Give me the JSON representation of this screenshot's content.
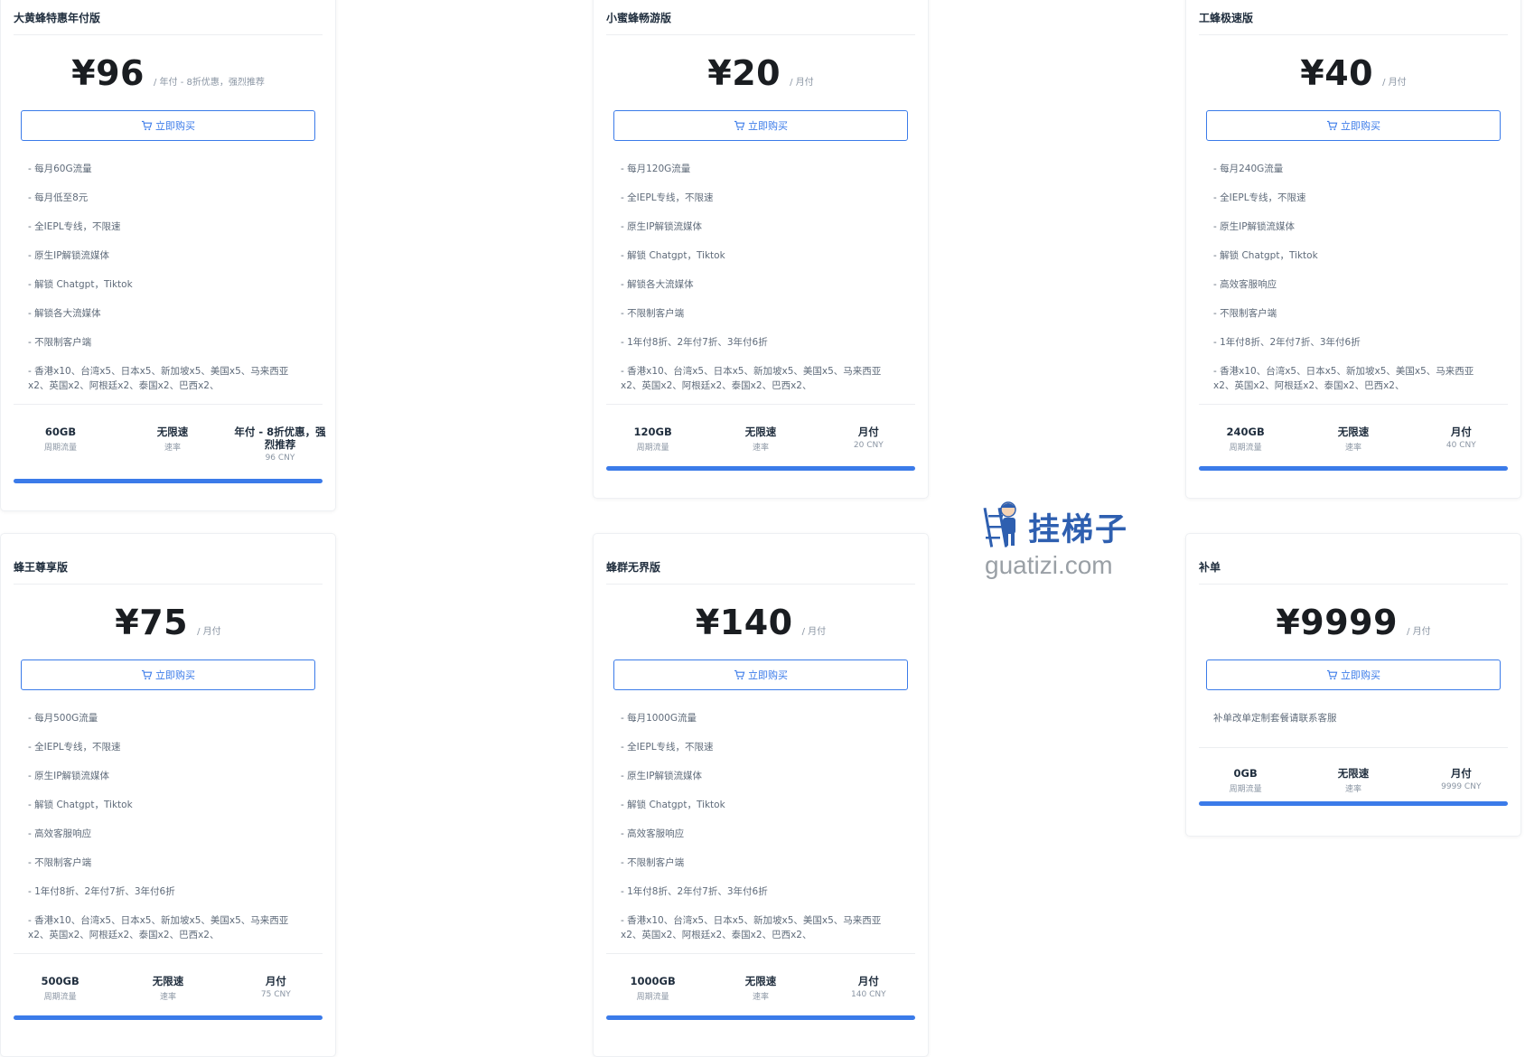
{
  "buy_label": "立即购买",
  "accent_color": "#3b7be9",
  "plans": [
    {
      "title": "大黄蜂特惠年付版",
      "price": "¥96",
      "period": "/ 年付 - 8折优惠，强烈推荐",
      "features": [
        "- 每月60G流量",
        "- 每月低至8元",
        "- 全IEPL专线，不限速",
        "- 原生IP解锁流媒体",
        "- 解锁 Chatgpt，Tiktok",
        "- 解锁各大流媒体",
        "- 不限制客户端",
        "- 香港x10、台湾x5、日本x5、新加坡x5、美国x5、马来西亚x2、英国x2、阿根廷x2、泰国x2、巴西x2、"
      ],
      "stats": [
        {
          "value": "60GB",
          "label": "周期流量"
        },
        {
          "value": "无限速",
          "label": "速率"
        },
        {
          "value": "年付 - 8折优惠，强烈推荐",
          "label": "96 CNY"
        }
      ]
    },
    {
      "title": "小蜜蜂畅游版",
      "price": "¥20",
      "period": "/ 月付",
      "features": [
        "- 每月120G流量",
        "- 全IEPL专线，不限速",
        "- 原生IP解锁流媒体",
        "- 解锁 Chatgpt，Tiktok",
        "- 解锁各大流媒体",
        "- 不限制客户端",
        "- 1年付8折、2年付7折、3年付6折",
        "- 香港x10、台湾x5、日本x5、新加坡x5、美国x5、马来西亚x2、英国x2、阿根廷x2、泰国x2、巴西x2、"
      ],
      "stats": [
        {
          "value": "120GB",
          "label": "周期流量"
        },
        {
          "value": "无限速",
          "label": "速率"
        },
        {
          "value": "月付",
          "label": "20 CNY"
        }
      ]
    },
    {
      "title": "工蜂极速版",
      "price": "¥40",
      "period": "/ 月付",
      "features": [
        "- 每月240G流量",
        "- 全IEPL专线，不限速",
        "- 原生IP解锁流媒体",
        "- 解锁 Chatgpt，Tiktok",
        "- 高效客服响应",
        "- 不限制客户端",
        "- 1年付8折、2年付7折、3年付6折",
        "- 香港x10、台湾x5、日本x5、新加坡x5、美国x5、马来西亚x2、英国x2、阿根廷x2、泰国x2、巴西x2、"
      ],
      "stats": [
        {
          "value": "240GB",
          "label": "周期流量"
        },
        {
          "value": "无限速",
          "label": "速率"
        },
        {
          "value": "月付",
          "label": "40 CNY"
        }
      ]
    },
    {
      "title": "蜂王尊享版",
      "price": "¥75",
      "period": "/ 月付",
      "features": [
        "- 每月500G流量",
        "- 全IEPL专线，不限速",
        "- 原生IP解锁流媒体",
        "- 解锁 Chatgpt，Tiktok",
        "- 高效客服响应",
        "- 不限制客户端",
        "- 1年付8折、2年付7折、3年付6折",
        "- 香港x10、台湾x5、日本x5、新加坡x5、美国x5、马来西亚x2、英国x2、阿根廷x2、泰国x2、巴西x2、"
      ],
      "stats": [
        {
          "value": "500GB",
          "label": "周期流量"
        },
        {
          "value": "无限速",
          "label": "速率"
        },
        {
          "value": "月付",
          "label": "75 CNY"
        }
      ]
    },
    {
      "title": "蜂群无界版",
      "price": "¥140",
      "period": "/ 月付",
      "features": [
        "- 每月1000G流量",
        "- 全IEPL专线，不限速",
        "- 原生IP解锁流媒体",
        "- 解锁 Chatgpt，Tiktok",
        "- 高效客服响应",
        "- 不限制客户端",
        "- 1年付8折、2年付7折、3年付6折",
        "- 香港x10、台湾x5、日本x5、新加坡x5、美国x5、马来西亚x2、英国x2、阿根廷x2、泰国x2、巴西x2、"
      ],
      "stats": [
        {
          "value": "1000GB",
          "label": "周期流量"
        },
        {
          "value": "无限速",
          "label": "速率"
        },
        {
          "value": "月付",
          "label": "140 CNY"
        }
      ]
    },
    {
      "title": "补单",
      "price": "¥9999",
      "period": "/ 月付",
      "features": [
        "补单改单定制套餐请联系客服"
      ],
      "stats": [
        {
          "value": "0GB",
          "label": "周期流量"
        },
        {
          "value": "无限速",
          "label": "速率"
        },
        {
          "value": "月付",
          "label": "9999 CNY"
        }
      ]
    }
  ],
  "watermark": {
    "brand_cn": "挂梯子",
    "brand_url": "guatizi.com"
  }
}
